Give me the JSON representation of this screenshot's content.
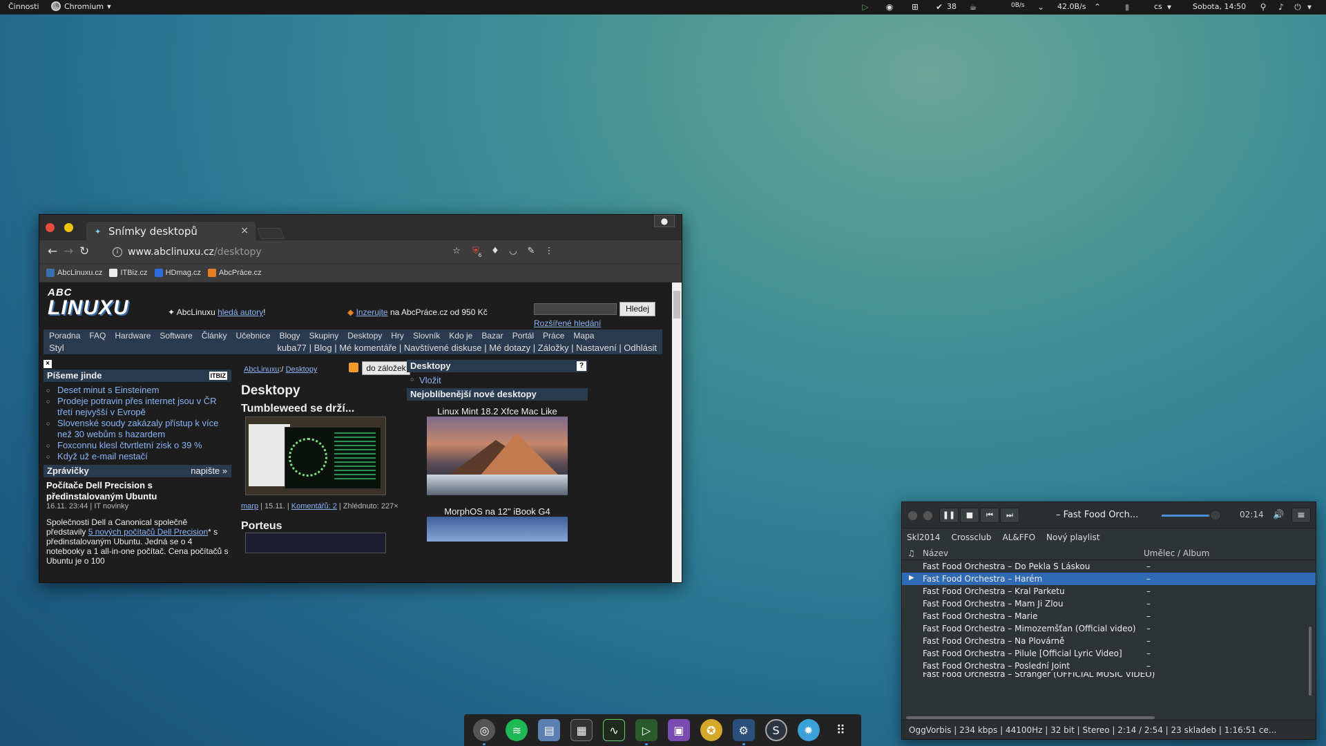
{
  "topbar": {
    "activities": "Činnosti",
    "app_name": "Chromium",
    "tasks_count": "38",
    "net_down": "0B/s",
    "net_up": "42.0B/s",
    "lang": "cs",
    "clock": "Sobota, 14:50"
  },
  "browser": {
    "tab_title": "Snímky desktopů",
    "url_host": "www.abclinuxu.cz",
    "url_path": "/desktopy",
    "bookmarks": [
      "AbcLinuxu.cz",
      "ITBiz.cz",
      "HDmag.cz",
      "AbcPráce.cz"
    ],
    "ext_badge": "6"
  },
  "site": {
    "logo_top": "ABC",
    "logo_main": "LINUXU",
    "hdr_prefix": "AbcLinuxu",
    "hdr_link": "hledá autory",
    "hdr_suffix": "!",
    "ad_link": "Inzerujte",
    "ad_text": "na AbcPráce.cz od 950 Kč",
    "search_button": "Hledej",
    "advanced_search": "Rozšířené hledání",
    "menu": [
      "Poradna",
      "FAQ",
      "Hardware",
      "Software",
      "Články",
      "Učebnice",
      "Blogy",
      "Skupiny",
      "Desktopy",
      "Hry",
      "Slovník",
      "Kdo je",
      "Bazar",
      "Portál",
      "Práce",
      "Mapa"
    ],
    "styl": "Styl",
    "user_menu": "kuba77 | Blog | Mé komentáře | Navštívené diskuse | Mé dotazy | Záložky | Nastavení | Odhlásit",
    "left": {
      "close": "×",
      "box1_title": "Píšeme jinde",
      "box1_badge": "ITBIZ",
      "box1_items": [
        "Deset minut s Einsteinem",
        "Prodeje potravin přes internet jsou v ČR třetí nejvyšší v Evropě",
        "Slovenské soudy zakázaly přístup k více než 30 webům s hazardem",
        "Foxconnu klesl čtvrtletní zisk o 39 %",
        "Když už e-mail nestačí"
      ],
      "box2_title": "Zprávičky",
      "box2_link": "napište »",
      "news_title": "Počítače Dell Precision s předinstalovaným Ubuntu",
      "news_meta": "16.11. 23:44 | IT novinky",
      "news_body_1": "Společnosti Dell a Canonical společně představily",
      "news_link": "5 nových počítačů Dell Precision",
      "news_body_2": "* s předinstalovaným Ubuntu. Jedná se o 4 notebooky a 1 all-in-one počítač. Cena počítačů s Ubuntu je o 100"
    },
    "mid": {
      "crumb_1": "AbcLinuxu",
      "crumb_sep": ":/",
      "crumb_2": "Desktopy",
      "bookmark_btn": "do záložek",
      "heading": "Desktopy",
      "item1_title": "Tumbleweed se drží...",
      "item1_author": "marp",
      "item1_date": "| 15.11. |",
      "item1_comments": "Komentářů: 2",
      "item1_views": "| Zhlédnuto: 227×",
      "item2_title": "Porteus"
    },
    "right": {
      "box_title": "Desktopy",
      "help": "?",
      "insert": "Vložit",
      "popular_title": "Nejoblíbenější nové desktopy",
      "cap1": "Linux Mint 18.2 Xfce Mac Like",
      "cap2": "MorphOS na 12\" iBook G4"
    }
  },
  "player": {
    "title": "– Fast Food Orch...",
    "time": "02:14",
    "seek_fraction": 0.85,
    "playlists": [
      "Skl2014",
      "Crossclub",
      "AL&FFO",
      "Nový playlist"
    ],
    "col_name": "Název",
    "col_artist": "Umělec / Album",
    "tracks": [
      {
        "name": "Fast Food Orchestra – Do Pekla S Láskou",
        "artist": "–"
      },
      {
        "name": "Fast Food Orchestra – Harém",
        "artist": "–"
      },
      {
        "name": "Fast Food Orchestra – Kral Parketu",
        "artist": "–"
      },
      {
        "name": "Fast Food Orchestra – Mam Ji Zlou",
        "artist": "–"
      },
      {
        "name": "Fast Food Orchestra – Marie",
        "artist": "–"
      },
      {
        "name": "Fast Food Orchestra – Mimozemšťan (Official video)",
        "artist": "–"
      },
      {
        "name": "Fast Food Orchestra – Na Plovárně",
        "artist": "–"
      },
      {
        "name": "Fast Food Orchestra – Pilule [Official Lyric Video]",
        "artist": "–"
      },
      {
        "name": "Fast Food Orchestra – Poslední Joint",
        "artist": "–"
      },
      {
        "name": "Fast Food Orchestra – Stranger (OFFICIAL MUSIC VIDEO)",
        "artist": ""
      }
    ],
    "status": "OggVorbis | 234 kbps | 44100Hz | 32 bit | Stereo | 2:14 / 2:54 | 23 skladeb | 1:16:51 ce..."
  },
  "dock": {
    "apps": [
      "chromium-icon",
      "spotify-icon",
      "files-icon",
      "terminal-icon",
      "system-monitor-icon",
      "media-player-icon",
      "window-manager-icon",
      "penguin-icon",
      "steam-icon",
      "s-app-icon",
      "settings-icon",
      "app-grid-icon"
    ]
  }
}
